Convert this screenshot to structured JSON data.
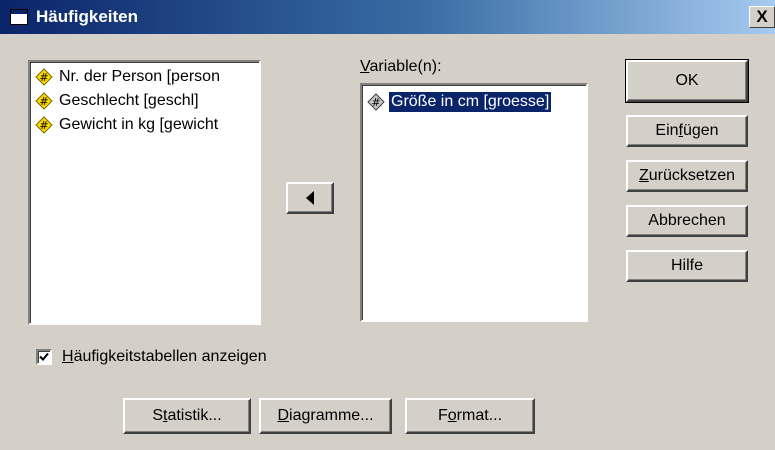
{
  "window": {
    "title": "Häufigkeiten",
    "close_label": "X"
  },
  "source_list": {
    "items": [
      {
        "label": "Nr. der Person [person",
        "icon": "numeric-variable-icon"
      },
      {
        "label": "Geschlecht [geschl]",
        "icon": "numeric-variable-icon"
      },
      {
        "label": "Gewicht in kg [gewicht",
        "icon": "numeric-variable-icon"
      }
    ]
  },
  "target_list": {
    "label_prefix": "",
    "label_underlined": "V",
    "label_rest": "ariable(n):",
    "items": [
      {
        "label": "Größe in cm [groesse]",
        "icon": "numeric-variable-icon",
        "selected": true
      }
    ]
  },
  "transfer_button": {
    "icon": "left-arrow-icon"
  },
  "buttons": {
    "ok": "OK",
    "paste_pre": "Ein",
    "paste_u": "f",
    "paste_post": "ügen",
    "reset_pre": "",
    "reset_u": "Z",
    "reset_post": "urücksetzen",
    "cancel": "Abbrechen",
    "help": "Hilfe"
  },
  "checkbox": {
    "checked": true,
    "label_u": "H",
    "label_rest": "äufigkeitstabellen anzeigen"
  },
  "bottom_buttons": {
    "statistics_pre": "S",
    "statistics_u": "t",
    "statistics_post": "atistik...",
    "charts_u": "D",
    "charts_post": "iagramme...",
    "format_pre": "F",
    "format_u": "o",
    "format_post": "rmat..."
  },
  "colors": {
    "dialog_bg": "#d4d0c8",
    "selection": "#0a246a",
    "icon_yellow": "#ffd800"
  }
}
